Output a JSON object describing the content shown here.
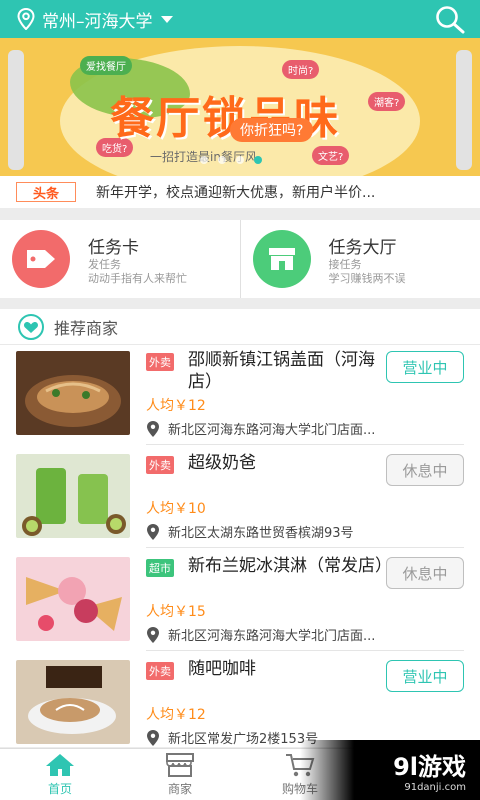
{
  "header": {
    "city": "常州–河海大学",
    "location_icon": "location-pin-icon",
    "search_icon": "search-icon"
  },
  "banner": {
    "title": "餐厅锁品味",
    "subtitle": "你折狂吗?",
    "slogan": "一招打造最in餐厅风",
    "tags": [
      "爱找餐厅",
      "吃货?",
      "时尚?",
      "潮客?",
      "文艺?"
    ],
    "slides": 4,
    "active_slide": 4
  },
  "headline": {
    "tag": "头条",
    "text": "新年开学，校点通迎新大优惠，新用户半价..."
  },
  "quick": [
    {
      "title": "任务卡",
      "desc1": "发任务",
      "desc2": "动动手指有人来帮忙",
      "color": "#f26b6b"
    },
    {
      "title": "任务大厅",
      "desc1": "接任务",
      "desc2": "学习赚钱两不误",
      "color": "#4ccc7a"
    }
  ],
  "section": {
    "title": "推荐商家"
  },
  "merchants": [
    {
      "badge": "外卖",
      "badge_color": "#f26b6b",
      "name": "邵顺新镇江锅盖面（河海店）",
      "price": "人均￥12",
      "address": "新北区河海东路河海大学北门店面...",
      "status": "营业中",
      "open": true
    },
    {
      "badge": "外卖",
      "badge_color": "#f26b6b",
      "name": "超级奶爸",
      "price": "人均￥10",
      "address": "新北区太湖东路世贸香槟湖93号",
      "status": "休息中",
      "open": false
    },
    {
      "badge": "超市",
      "badge_color": "#3cc47c",
      "name": "新布兰妮冰淇淋（常发店）",
      "price": "人均￥15",
      "address": "新北区河海东路河海大学北门店面...",
      "status": "休息中",
      "open": false
    },
    {
      "badge": "外卖",
      "badge_color": "#f26b6b",
      "name": "随吧咖啡",
      "price": "人均￥12",
      "address": "新北区常发广场2楼153号",
      "status": "营业中",
      "open": true
    }
  ],
  "tabs": [
    {
      "label": "首页",
      "icon": "home-icon",
      "active": true
    },
    {
      "label": "商家",
      "icon": "store-icon",
      "active": false
    },
    {
      "label": "购物车",
      "icon": "cart-icon",
      "active": false
    }
  ],
  "watermark": {
    "logo": "9l游戏",
    "site": "91danji.com"
  },
  "colors": {
    "accent": "#2ec5b2",
    "price": "#ff8c1a"
  }
}
